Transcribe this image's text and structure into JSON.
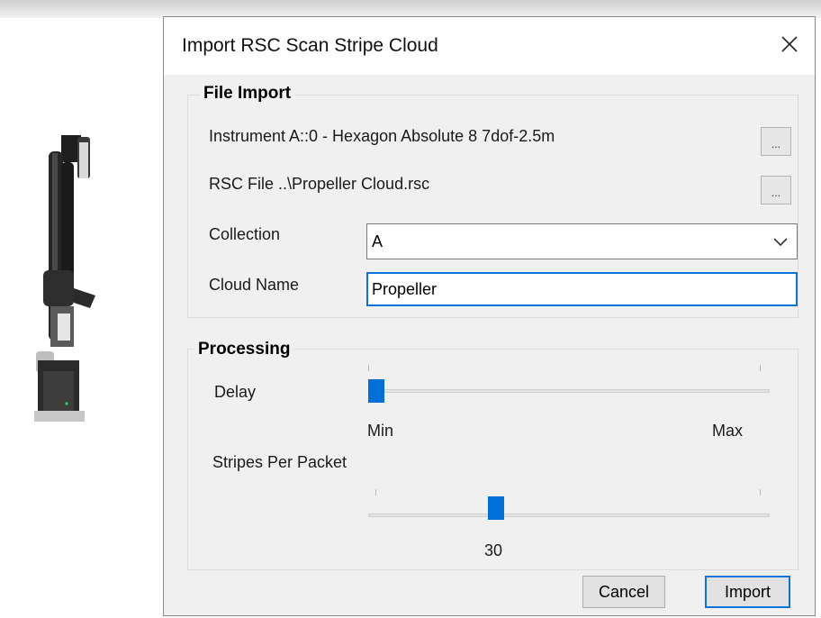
{
  "dialog": {
    "title": "Import RSC Scan Stripe Cloud"
  },
  "file_import": {
    "legend": "File Import",
    "instrument_label": "Instrument A::0 - Hexagon Absolute 8 7dof-2.5m",
    "instrument_browse": "...",
    "rsc_file_label": "RSC File  ..\\Propeller Cloud.rsc",
    "rsc_browse": "...",
    "collection_label": "Collection",
    "collection_value": "A",
    "cloud_name_label": "Cloud Name",
    "cloud_name_value": "Propeller"
  },
  "processing": {
    "legend": "Processing",
    "delay_label": "Delay",
    "delay_min": "Min",
    "delay_max": "Max",
    "delay_level": 0,
    "stripes_label": "Stripes Per Packet",
    "stripes_value": "30",
    "stripes_level": 0.31
  },
  "buttons": {
    "cancel": "Cancel",
    "import": "Import"
  },
  "colors": {
    "accent": "#0a74da",
    "slider_thumb": "#0070d8"
  },
  "icons": {
    "close": "close-icon",
    "dropdown": "chevron-down-icon"
  }
}
